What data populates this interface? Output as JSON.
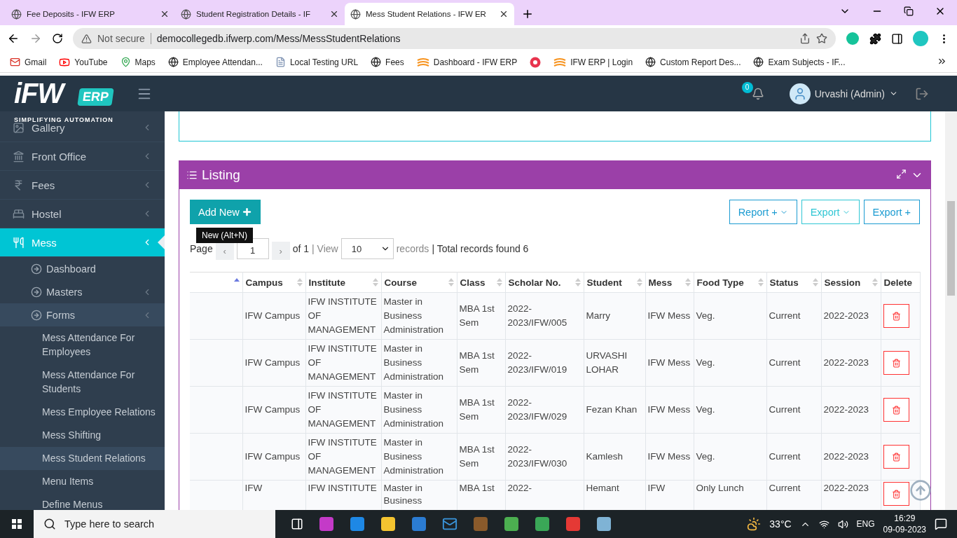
{
  "browser": {
    "tabs": [
      {
        "title": "Fee Deposits - IFW ERP",
        "selected": false
      },
      {
        "title": "Student Registration Details - IF",
        "selected": false
      },
      {
        "title": "Mess Student Relations - IFW ER",
        "selected": true
      }
    ],
    "security": "Not secure",
    "url": "democollegedb.ifwerp.com/Mess/MessStudentRelations",
    "bookmarks": [
      {
        "kind": "gmail",
        "label": "Gmail"
      },
      {
        "kind": "youtube",
        "label": "YouTube"
      },
      {
        "kind": "maps",
        "label": "Maps"
      },
      {
        "kind": "globe",
        "label": "Employee Attendan..."
      },
      {
        "kind": "doc",
        "label": "Local Testing URL"
      },
      {
        "kind": "globe",
        "label": "Fees"
      },
      {
        "kind": "ifw",
        "label": "Dashboard - IFW ERP"
      },
      {
        "kind": "target"
      },
      {
        "kind": "ifw",
        "label": "IFW ERP | Login"
      },
      {
        "kind": "globe",
        "label": "Custom Report Des..."
      },
      {
        "kind": "globe",
        "label": "Exam Subjects - IF..."
      }
    ]
  },
  "header": {
    "logo": "iFW",
    "logo_badge": "ERP",
    "tagline": "SIMPLIFYING AUTOMATION",
    "notifications": "0",
    "user": "Urvashi (Admin)"
  },
  "sidebar": {
    "items": [
      {
        "kind": "gallery",
        "label": "Gallery",
        "selected": false
      },
      {
        "kind": "office",
        "label": "Front Office",
        "selected": false
      },
      {
        "kind": "fees",
        "label": "Fees",
        "selected": false
      },
      {
        "kind": "hostel",
        "label": "Hostel",
        "selected": false
      },
      {
        "kind": "mess",
        "label": "Mess",
        "selected": true,
        "children": [
          {
            "label": "Dashboard",
            "expandable": false,
            "expanded": false
          },
          {
            "label": "Masters",
            "expandable": true,
            "expanded": false
          },
          {
            "label": "Forms",
            "expandable": true,
            "expanded": true,
            "children": [
              {
                "label": "Mess Attendance For Employees",
                "selected": false
              },
              {
                "label": "Mess Attendance For Students",
                "selected": false
              },
              {
                "label": "Mess Employee Relations",
                "selected": false
              },
              {
                "label": "Mess Shifting",
                "selected": false
              },
              {
                "label": "Mess Student Relations",
                "selected": true
              },
              {
                "label": "Menu Items",
                "selected": false
              },
              {
                "label": "Define Menus",
                "selected": false
              }
            ]
          }
        ]
      }
    ]
  },
  "listing": {
    "title": "Listing",
    "add_button": "Add New",
    "tooltip": "New (Alt+N)",
    "buttons": [
      {
        "label": "Report +",
        "caret": true,
        "selected": true
      },
      {
        "label": "Export",
        "caret": true,
        "selected": false
      },
      {
        "label": "Export +",
        "caret": false,
        "selected": true
      }
    ],
    "pager": {
      "page_label": "Page",
      "prev": "‹",
      "page": "1",
      "next": "›",
      "of": "of 1",
      "view": "| View",
      "page_size": "10",
      "records": "records",
      "total": "| Total records found 6"
    },
    "table": {
      "columns": [
        {
          "kind": "sorted"
        },
        {
          "label": "Campus",
          "kind": "sortable"
        },
        {
          "label": "Institute",
          "kind": "sortable"
        },
        {
          "label": "Course",
          "kind": "sortable"
        },
        {
          "label": "Class",
          "kind": "sortable"
        },
        {
          "label": "Scholar No.",
          "kind": "sortable"
        },
        {
          "label": "Student",
          "kind": "sortable"
        },
        {
          "label": "Mess",
          "kind": "sortable"
        },
        {
          "label": "Food Type",
          "kind": "sortable"
        },
        {
          "label": "Status",
          "kind": "sortable"
        },
        {
          "label": "Session",
          "kind": "sortable"
        },
        {
          "label": "Delete",
          "kind": "plain"
        }
      ],
      "rows": [
        [
          "",
          "IFW Campus",
          "IFW INSTITUTE OF MANAGEMENT",
          "Master in Business Administration",
          "MBA 1st Sem",
          "2022-2023/IFW/005",
          "Marry",
          "IFW Mess",
          "Veg.",
          "Current",
          "2022-2023"
        ],
        [
          "",
          "IFW Campus",
          "IFW INSTITUTE OF MANAGEMENT",
          "Master in Business Administration",
          "MBA 1st Sem",
          "2022-2023/IFW/019",
          "URVASHI LOHAR",
          "IFW Mess",
          "Veg.",
          "Current",
          "2022-2023"
        ],
        [
          "",
          "IFW Campus",
          "IFW INSTITUTE OF MANAGEMENT",
          "Master in Business Administration",
          "MBA 1st Sem",
          "2022-2023/IFW/029",
          "Fezan Khan",
          "IFW Mess",
          "Veg.",
          "Current",
          "2022-2023"
        ],
        [
          "",
          "IFW Campus",
          "IFW INSTITUTE OF MANAGEMENT",
          "Master in Business Administration",
          "MBA 1st Sem",
          "2022-2023/IFW/030",
          "Kamlesh",
          "IFW Mess",
          "Veg.",
          "Current",
          "2022-2023"
        ],
        [
          "",
          "IFW",
          "IFW INSTITUTE",
          "Master in Business",
          "MBA 1st",
          "2022-",
          "Hemant",
          "IFW",
          "Only Lunch",
          "Current",
          "2022-2023"
        ]
      ]
    }
  },
  "taskbar": {
    "search": "Type here to search",
    "temperature": "33°C",
    "language": "ENG",
    "time": "16:29",
    "date": "09-09-2023"
  }
}
